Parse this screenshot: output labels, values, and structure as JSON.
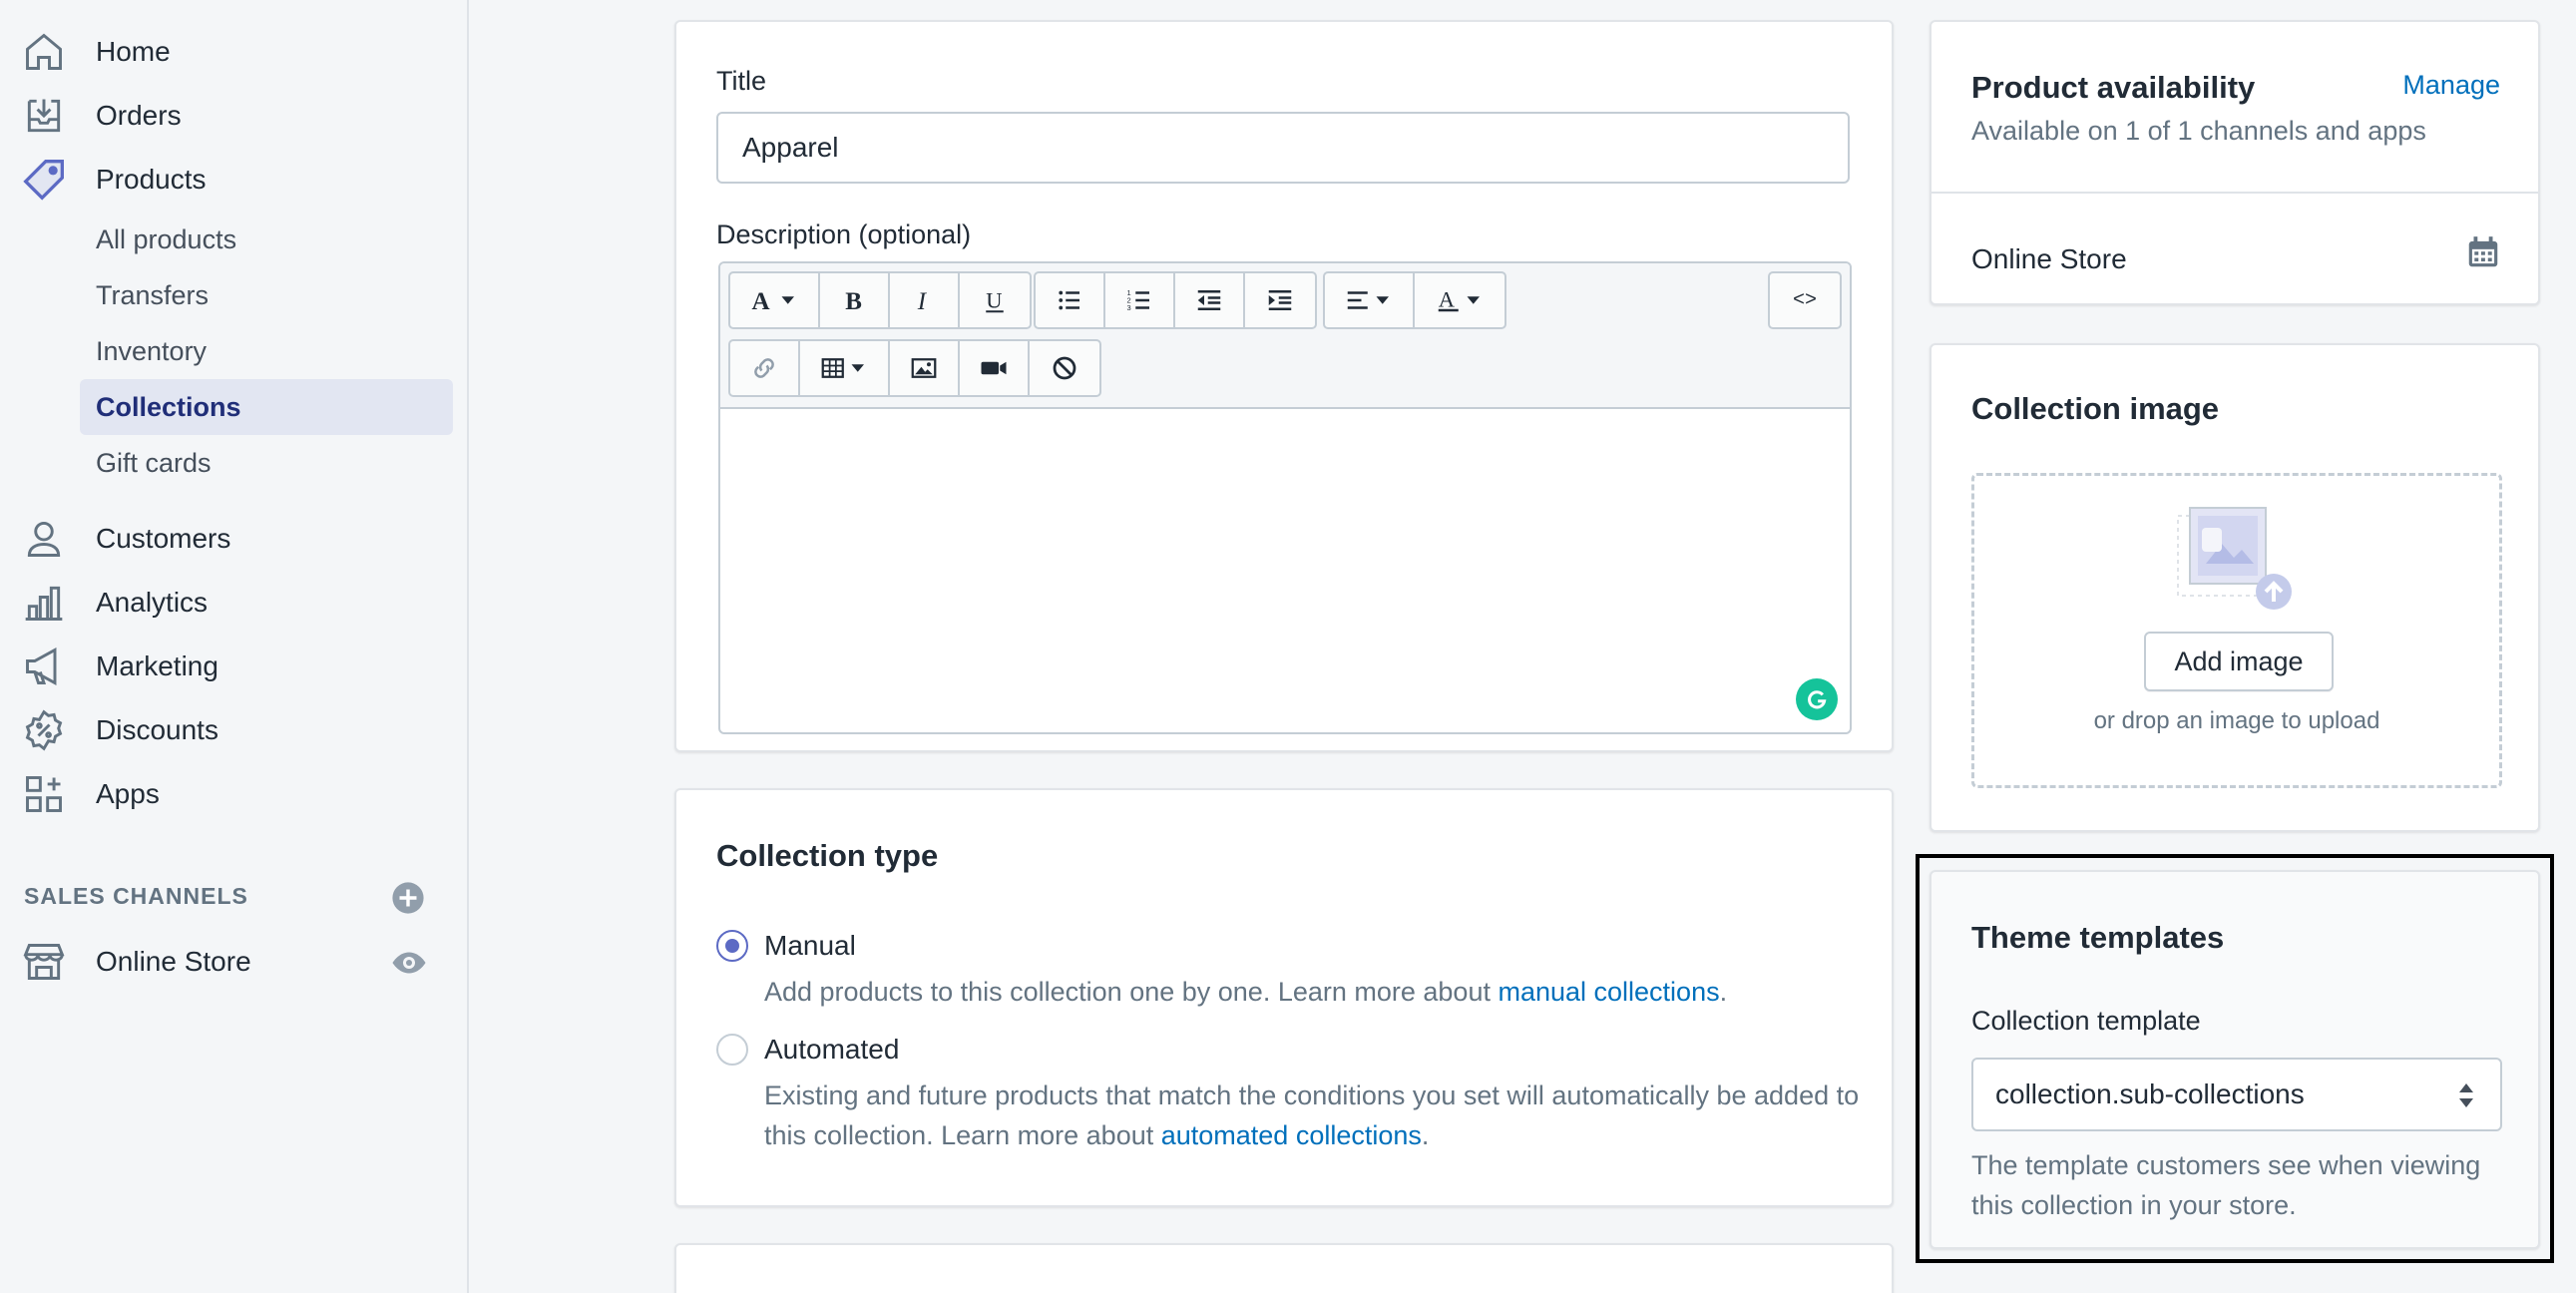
{
  "sidebar": {
    "items": [
      {
        "label": "Home",
        "icon": "home-icon"
      },
      {
        "label": "Orders",
        "icon": "orders-icon"
      },
      {
        "label": "Products",
        "icon": "tag-icon"
      },
      {
        "label": "Customers",
        "icon": "person-icon"
      },
      {
        "label": "Analytics",
        "icon": "bar-chart-icon"
      },
      {
        "label": "Marketing",
        "icon": "megaphone-icon"
      },
      {
        "label": "Discounts",
        "icon": "discount-icon"
      },
      {
        "label": "Apps",
        "icon": "apps-icon"
      }
    ],
    "product_subitems": [
      "All products",
      "Transfers",
      "Inventory",
      "Collections",
      "Gift cards"
    ],
    "active_subitem": "Collections",
    "sales_channels_heading": "SALES CHANNELS",
    "channels": [
      {
        "label": "Online Store",
        "icon": "store-icon"
      }
    ]
  },
  "main": {
    "title_label": "Title",
    "title_value": "Apparel",
    "description_label": "Description (optional)",
    "html_toggle": "<>",
    "collection_type": {
      "heading": "Collection type",
      "options": [
        {
          "label": "Manual",
          "checked": true,
          "help_prefix": "Add products to this collection one by one. Learn more about ",
          "help_link": "manual collections",
          "help_suffix": "."
        },
        {
          "label": "Automated",
          "checked": false,
          "help_prefix": "Existing and future products that match the conditions you set will automatically be added to this collection. Learn more about ",
          "help_link": "automated collections",
          "help_suffix": "."
        }
      ]
    }
  },
  "aside": {
    "availability": {
      "heading": "Product availability",
      "manage_link": "Manage",
      "subtext": "Available on 1 of 1 channels and apps",
      "channel": "Online Store"
    },
    "image": {
      "heading": "Collection image",
      "button": "Add image",
      "hint": "or drop an image to upload"
    },
    "templates": {
      "heading": "Theme templates",
      "label": "Collection template",
      "selected": "collection.sub-collections",
      "help": "The template customers see when viewing this collection in your store."
    }
  },
  "colors": {
    "accent": "#5c6ac4",
    "link": "#006fbb",
    "active_nav_bg": "#e2e6f2",
    "active_nav_text": "#202e78"
  }
}
